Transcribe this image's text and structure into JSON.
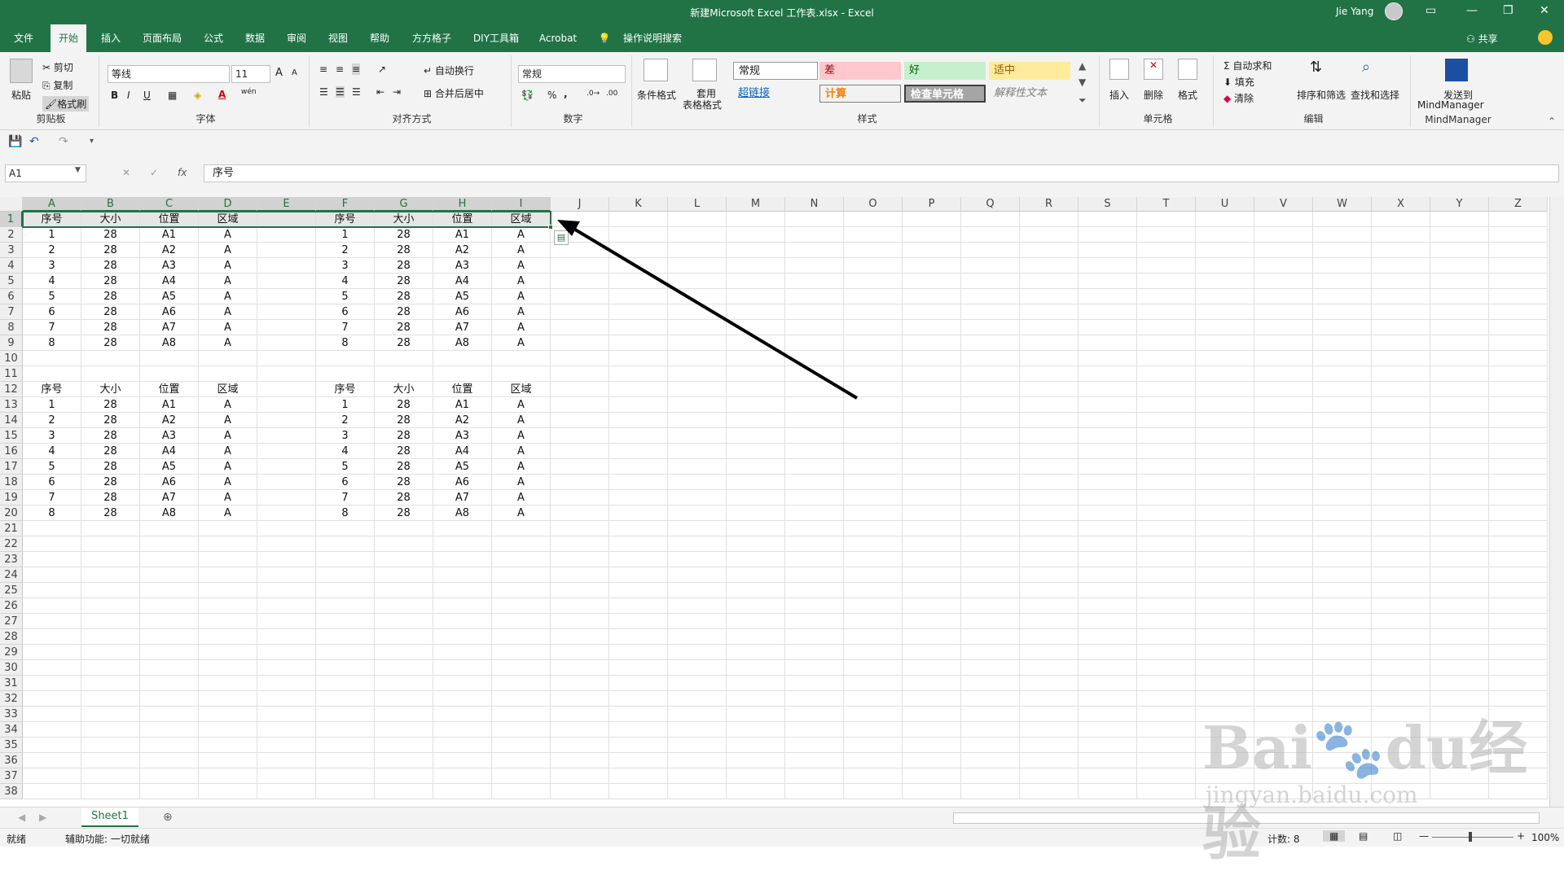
{
  "app": {
    "title": "新建Microsoft Excel 工作表.xlsx  -  Excel",
    "user": "Jie Yang",
    "share": "共享"
  },
  "tabs": [
    "文件",
    "开始",
    "插入",
    "页面布局",
    "公式",
    "数据",
    "审阅",
    "视图",
    "帮助",
    "方方格子",
    "DIY工具箱",
    "Acrobat"
  ],
  "tell_me": "操作说明搜索",
  "ribbon": {
    "clipboard": {
      "paste": "粘贴",
      "cut": "剪切",
      "copy": "复制",
      "format_painter": "格式刷",
      "label": "剪贴板"
    },
    "font": {
      "name": "等线",
      "size": "11",
      "label": "字体",
      "wen": "wén",
      "bold": "B",
      "italic": "I",
      "underline": "U",
      "font_color": "A",
      "grow": "A",
      "shrink": "A"
    },
    "alignment": {
      "wrap": "自动换行",
      "merge": "合并后居中",
      "label": "对齐方式"
    },
    "number": {
      "format": "常规",
      "percent": "%",
      "comma": ",",
      "label": "数字"
    },
    "styles": {
      "cond": "条件格式",
      "table_line1": "套用",
      "table_line2": "表格格式",
      "normal": "常规",
      "bad": "差",
      "good": "好",
      "neutral": "适中",
      "hyperlink": "超链接",
      "calc": "计算",
      "check": "检查单元格",
      "explain": "解释性文本",
      "label": "样式"
    },
    "cells": {
      "insert": "插入",
      "delete": "删除",
      "format": "格式",
      "label": "单元格"
    },
    "editing": {
      "autosum": "自动求和",
      "fill": "填充",
      "clear": "清除",
      "sort": "排序和筛选",
      "find": "查找和选择",
      "label": "编辑"
    },
    "mindmanager": {
      "send1": "发送到",
      "send2": "MindManager",
      "label": "MindManager"
    }
  },
  "namebox": "A1",
  "fx": "fx",
  "formula": "序号",
  "columns": [
    "A",
    "B",
    "C",
    "D",
    "E",
    "F",
    "G",
    "H",
    "I",
    "J",
    "K",
    "L",
    "M",
    "N",
    "O",
    "P",
    "Q",
    "R",
    "S",
    "T",
    "U",
    "V",
    "W",
    "X",
    "Y",
    "Z"
  ],
  "rows": [
    "1",
    "2",
    "3",
    "4",
    "5",
    "6",
    "7",
    "8",
    "9",
    "10",
    "11",
    "12",
    "13",
    "14",
    "15",
    "16",
    "17",
    "18",
    "19",
    "20",
    "21",
    "22",
    "23",
    "24",
    "25",
    "26",
    "27",
    "28",
    "29",
    "30",
    "31",
    "32",
    "33",
    "34",
    "35",
    "36",
    "37",
    "38"
  ],
  "tables": [
    {
      "header": [
        "序号",
        "大小",
        "位置",
        "区域"
      ],
      "data": [
        [
          "1",
          "28",
          "A1",
          "A"
        ],
        [
          "2",
          "28",
          "A2",
          "A"
        ],
        [
          "3",
          "28",
          "A3",
          "A"
        ],
        [
          "4",
          "28",
          "A4",
          "A"
        ],
        [
          "5",
          "28",
          "A5",
          "A"
        ],
        [
          "6",
          "28",
          "A6",
          "A"
        ],
        [
          "7",
          "28",
          "A7",
          "A"
        ],
        [
          "8",
          "28",
          "A8",
          "A"
        ]
      ]
    },
    {
      "header": [
        "序号",
        "大小",
        "位置",
        "区域"
      ],
      "data": [
        [
          "1",
          "28",
          "A1",
          "A"
        ],
        [
          "2",
          "28",
          "A2",
          "A"
        ],
        [
          "3",
          "28",
          "A3",
          "A"
        ],
        [
          "4",
          "28",
          "A4",
          "A"
        ],
        [
          "5",
          "28",
          "A5",
          "A"
        ],
        [
          "6",
          "28",
          "A6",
          "A"
        ],
        [
          "7",
          "28",
          "A7",
          "A"
        ],
        [
          "8",
          "28",
          "A8",
          "A"
        ]
      ]
    },
    {
      "header": [
        "序号",
        "大小",
        "位置",
        "区域"
      ],
      "data": [
        [
          "1",
          "28",
          "A1",
          "A"
        ],
        [
          "2",
          "28",
          "A2",
          "A"
        ],
        [
          "3",
          "28",
          "A3",
          "A"
        ],
        [
          "4",
          "28",
          "A4",
          "A"
        ],
        [
          "5",
          "28",
          "A5",
          "A"
        ],
        [
          "6",
          "28",
          "A6",
          "A"
        ],
        [
          "7",
          "28",
          "A7",
          "A"
        ],
        [
          "8",
          "28",
          "A8",
          "A"
        ]
      ]
    },
    {
      "header": [
        "序号",
        "大小",
        "位置",
        "区域"
      ],
      "data": [
        [
          "1",
          "28",
          "A1",
          "A"
        ],
        [
          "2",
          "28",
          "A2",
          "A"
        ],
        [
          "3",
          "28",
          "A3",
          "A"
        ],
        [
          "4",
          "28",
          "A4",
          "A"
        ],
        [
          "5",
          "28",
          "A5",
          "A"
        ],
        [
          "6",
          "28",
          "A6",
          "A"
        ],
        [
          "7",
          "28",
          "A7",
          "A"
        ],
        [
          "8",
          "28",
          "A8",
          "A"
        ]
      ]
    }
  ],
  "sheet": {
    "tab": "Sheet1"
  },
  "status": {
    "ready": "就绪",
    "accessibility": "辅助功能: 一切就绪",
    "count": "计数: 8",
    "zoom": "100%"
  },
  "watermark": {
    "text1": "Bai",
    "text2": "du",
    "text3": "经验",
    "url": "jingyan.baidu.com"
  },
  "colors": {
    "excel_green": "#217346",
    "bad_bg": "#ffc7ce",
    "good_bg": "#c6efce",
    "neutral_bg": "#ffeb9c"
  }
}
